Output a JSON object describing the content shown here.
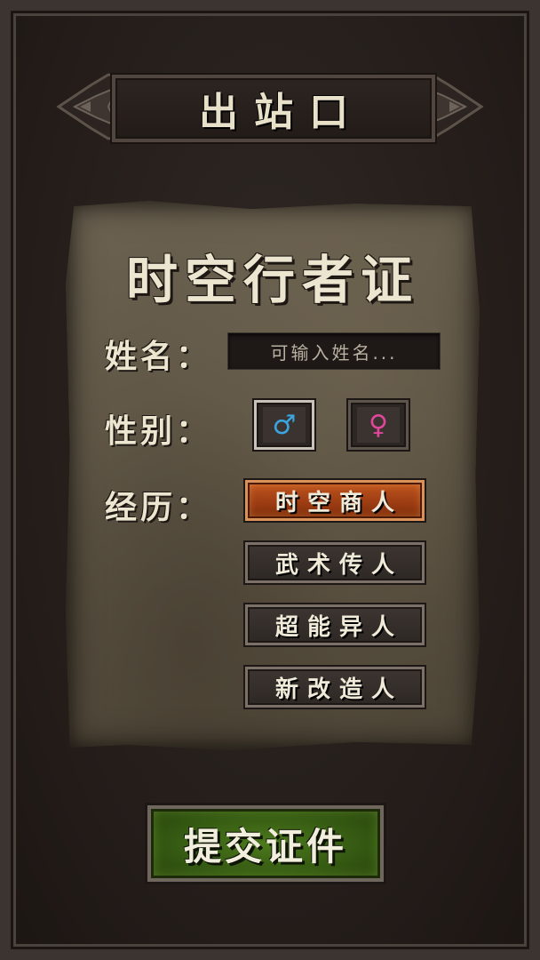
{
  "header": {
    "title": "出站口"
  },
  "card": {
    "title": "时空行者证",
    "name_label": "姓名：",
    "name_placeholder": "可输入姓名...",
    "gender_label": "性别：",
    "gender_options": [
      {
        "symbol": "♂",
        "color": "#3aa6e0",
        "selected": true
      },
      {
        "symbol": "♀",
        "color": "#e0479a",
        "selected": false
      }
    ],
    "experience_label": "经历：",
    "experience_options": [
      {
        "label": "时空商人",
        "selected": true
      },
      {
        "label": "武术传人",
        "selected": false
      },
      {
        "label": "超能异人",
        "selected": false
      },
      {
        "label": "新改造人",
        "selected": false
      }
    ]
  },
  "submit": {
    "label": "提交证件"
  },
  "colors": {
    "accent_selected": "#c0561f",
    "submit_green": "#4c7a1c"
  }
}
